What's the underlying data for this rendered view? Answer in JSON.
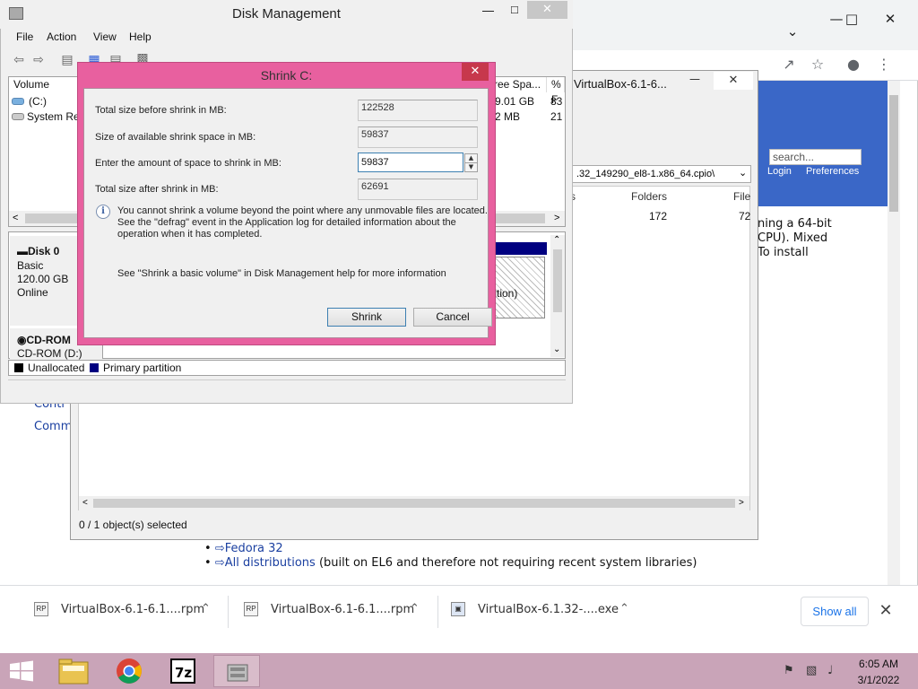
{
  "disk_management": {
    "title": "Disk Management",
    "menu": [
      "File",
      "Action",
      "View",
      "Help"
    ],
    "volume_columns": [
      "Volume",
      "ree Spa...",
      "% F"
    ],
    "volumes": [
      {
        "name": "(C:)",
        "free": "9.01 GB",
        "pct": "83"
      },
      {
        "name": "System Res",
        "free": "2 MB",
        "pct": "21"
      }
    ],
    "disks": [
      {
        "name": "Disk 0",
        "type": "Basic",
        "size": "120.00 GB",
        "status": "Online"
      },
      {
        "name": "CD-ROM",
        "type": "CD-ROM (D:)"
      }
    ],
    "partition_text": "tition)",
    "legend": [
      "Unallocated",
      "Primary partition"
    ],
    "legend_colors": [
      "#000000",
      "#000080"
    ]
  },
  "shrink_dialog": {
    "title": "Shrink C:",
    "labels": {
      "total_before": "Total size before shrink in MB:",
      "available": "Size of available shrink space in MB:",
      "amount": "Enter the amount of space to shrink in MB:",
      "total_after": "Total size after shrink in MB:"
    },
    "values": {
      "total_before": "122528",
      "available": "59837",
      "amount": "59837",
      "total_after": "62691"
    },
    "info_lines": [
      "You cannot shrink a volume beyond the point where any unmovable files are located.",
      "See the \"defrag\" event in the Application log for detailed information about the",
      "operation when it has completed."
    ],
    "help_text": "See \"Shrink a basic volume\" in Disk Management help for more information",
    "shrink_label": "Shrink",
    "cancel_label": "Cancel"
  },
  "sevenzip": {
    "title": "VirtualBox-6.1-6...",
    "path": ".32_149290_el8-1.x86_64.cpio\\",
    "columns": [
      "s",
      "Folders",
      "File"
    ],
    "row": [
      "172",
      "72"
    ],
    "status": "0 / 1 object(s) selected"
  },
  "web": {
    "search_placeholder": "search...",
    "login": "Login",
    "preferences": "Preferences",
    "snippets": [
      "ning a 64-bit",
      "CPU). Mixed",
      "To install"
    ],
    "left_links": [
      "Contr",
      "Comm"
    ],
    "list_items": [
      "Fedora 32",
      "All distributions"
    ],
    "list_suffix": " (built on EL6 and therefore not requiring recent system libraries)"
  },
  "downloads": [
    {
      "name": "VirtualBox-6.1-6.1....rpm"
    },
    {
      "name": "VirtualBox-6.1-6.1....rpm"
    },
    {
      "name": "VirtualBox-6.1.32-....exe"
    }
  ],
  "show_all": "Show all",
  "clock": {
    "time": "6:05 AM",
    "date": "3/1/2022"
  }
}
